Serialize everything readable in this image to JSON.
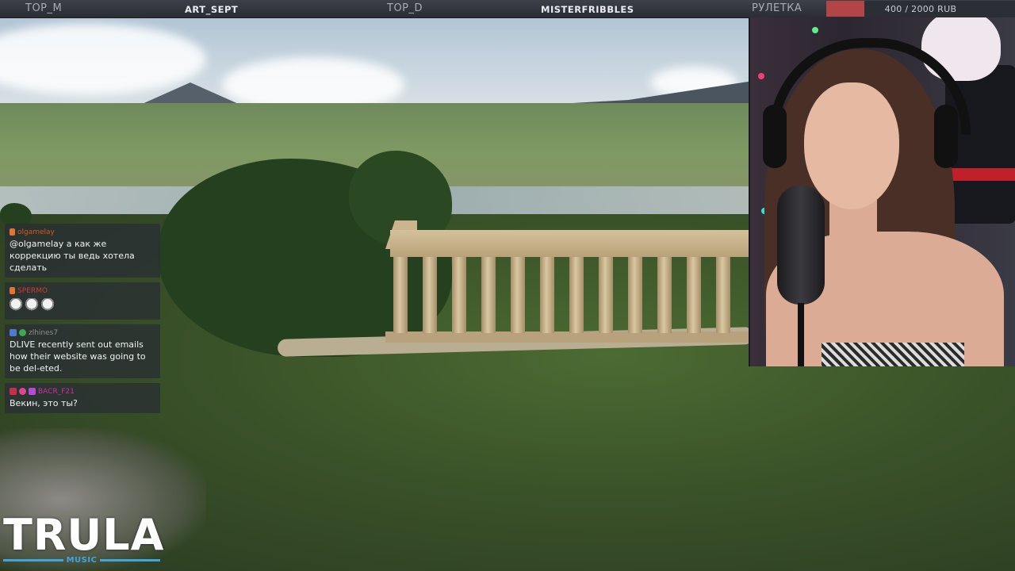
{
  "top_bar": {
    "items": [
      "TOP_M",
      "ART_SEPT",
      "TOP_D",
      "MISTERFRIBBLES",
      "РУЛЕТКА"
    ],
    "progress": {
      "current": 400,
      "goal": 2000,
      "fraction": 0.2,
      "text": "400 / 2000 RUB",
      "fill_color": "#b34549"
    }
  },
  "chat": {
    "messages": [
      {
        "username": "olgamelay",
        "text": "@olgamelay а как же коррекцию ты ведь хотела сделать",
        "name_color": "#d05a1e"
      },
      {
        "username": "SPERMO",
        "text": "",
        "emotes": [
          "emote",
          "emote",
          "emote"
        ],
        "name_color": "#d03b32"
      },
      {
        "username": "zlhines7",
        "text": "DLIVE recently sent out emails how their website was going to be del-eted.",
        "name_color": "#8e8e8e"
      },
      {
        "username": "BACR_F21",
        "text": "Векин, это ты?",
        "name_color": "#cc2fa8"
      }
    ]
  },
  "logo": {
    "title": "TRULA",
    "subtitle": "MUSIC",
    "accent": "#3fa6dd"
  }
}
